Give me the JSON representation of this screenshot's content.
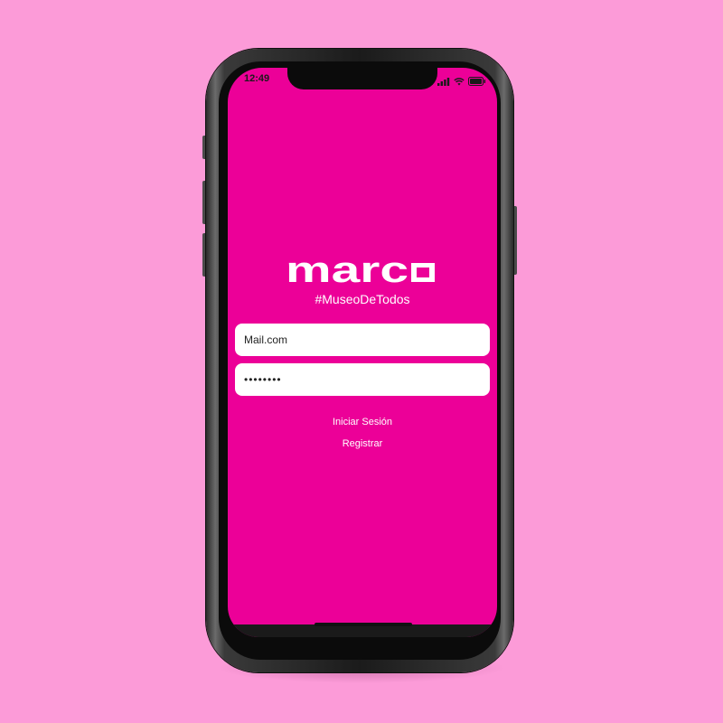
{
  "status_bar": {
    "time": "12:49",
    "icons": [
      "signal-icon",
      "wifi-icon",
      "battery-icon"
    ]
  },
  "app": {
    "logo_text": "marco",
    "tagline": "#MuseoDeTodos"
  },
  "form": {
    "email_value": "Mail.com",
    "password_value": "••••••••"
  },
  "actions": {
    "login_label": "Iniciar Sesión",
    "register_label": "Registrar"
  },
  "colors": {
    "background": "#fc9bd8",
    "screen": "#ec0098",
    "text": "#ffffff"
  }
}
